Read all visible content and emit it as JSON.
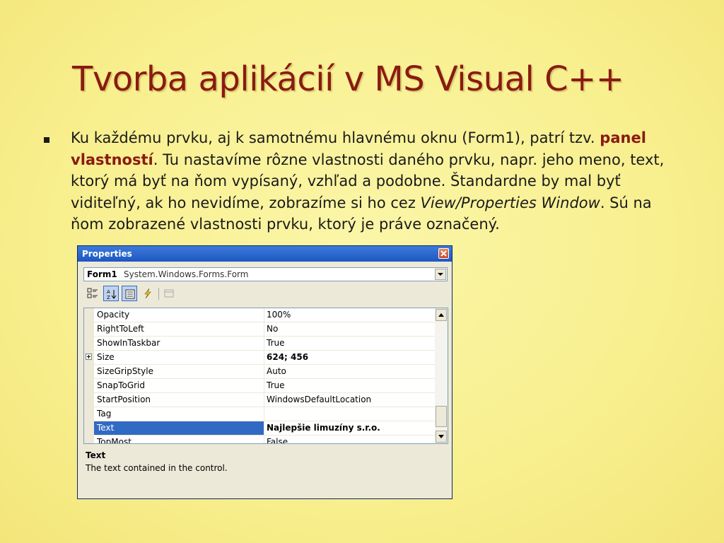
{
  "slide": {
    "title": "Tvorba aplikácií v MS Visual C++",
    "bullet": {
      "part1": "Ku každému prvku, aj k samotnému hlavnému oknu (Form1), patrí tzv.",
      "highlight": "panel vlastností",
      "part2": ". Tu nastavíme rôzne vlastnosti daného prvku, napr. jeho meno, text, ktorý má byť na ňom vypísaný, vzhľad a podobne. Štandardne by mal byť viditeľný, ak ho nevidíme, zobrazíme si ho cez ",
      "italic": "View/Properties Window",
      "part3": ". Sú na ňom zobrazené vlastnosti prvku, ktorý je práve označený."
    },
    "colors": {
      "title": "#8a1a12",
      "background": "#f8ef8e",
      "selection": "#316ac5"
    }
  },
  "properties": {
    "title": "Properties",
    "object_name": "Form1",
    "object_type": "System.Windows.Forms.Form",
    "toolbar_icons": [
      "categorized-icon",
      "alphabetical-icon",
      "properties-icon",
      "events-icon",
      "property-pages-icon"
    ],
    "rows": [
      {
        "name": "Opacity",
        "value": "100%"
      },
      {
        "name": "RightToLeft",
        "value": "No"
      },
      {
        "name": "ShowInTaskbar",
        "value": "True"
      },
      {
        "name": "Size",
        "value": "624; 456"
      },
      {
        "name": "SizeGripStyle",
        "value": "Auto"
      },
      {
        "name": "SnapToGrid",
        "value": "True"
      },
      {
        "name": "StartPosition",
        "value": "WindowsDefaultLocation"
      },
      {
        "name": "Tag",
        "value": ""
      },
      {
        "name": "Text",
        "value": "Najlepšie limuzíny s.r.o."
      },
      {
        "name": "TopMost",
        "value": "False"
      }
    ],
    "description_title": "Text",
    "description_text": "The text contained in the control."
  }
}
